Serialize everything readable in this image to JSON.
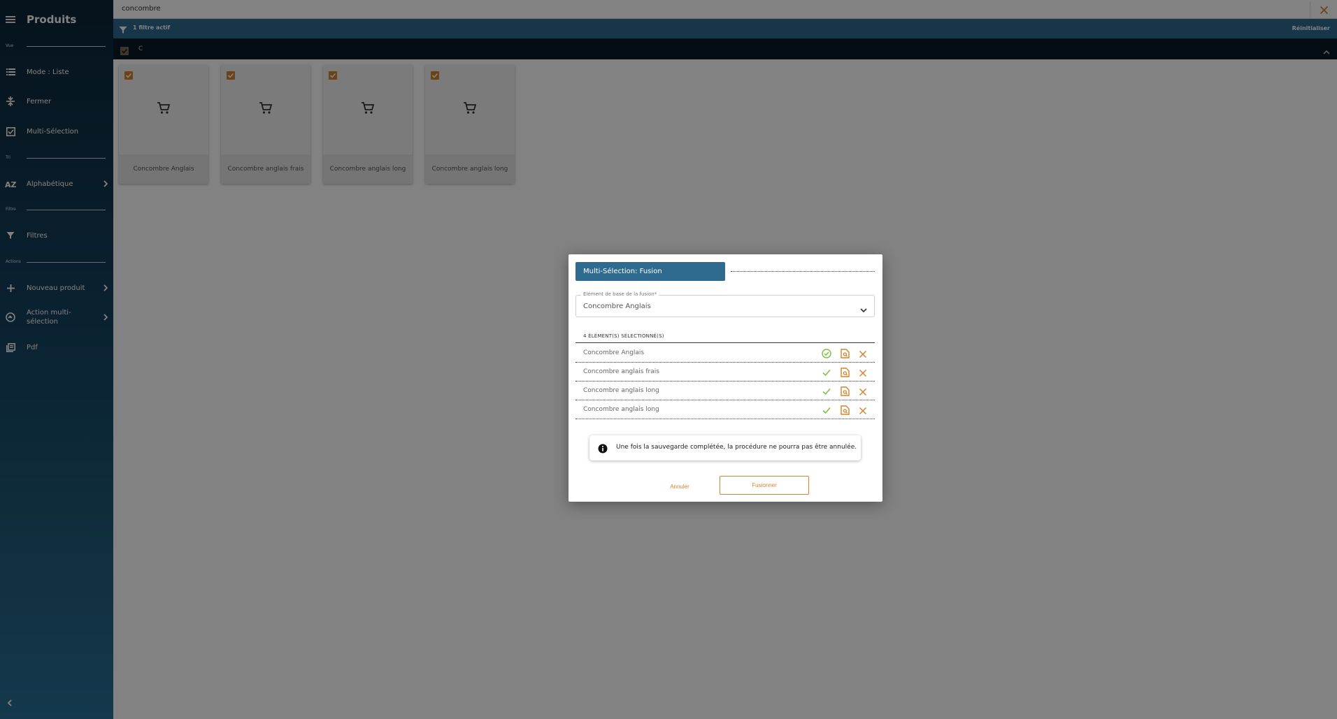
{
  "sidebar": {
    "title": "Produits",
    "sections": {
      "vue": "Vue",
      "tri": "Tri",
      "filtre": "Filtre",
      "actions": "Actions"
    },
    "items": {
      "mode": "Mode : Liste",
      "fermer": "Fermer",
      "multi": "Multi-Sélection",
      "alpha": "Alphabétique",
      "filtres": "Filtres",
      "nouveau": "Nouveau produit",
      "action_multi": "Action multi-sélection",
      "pdf": "Pdf"
    }
  },
  "search": {
    "value": "concombre"
  },
  "filterbar": {
    "count_label": "1 filtre actif",
    "reset_label": "Réinitialiser"
  },
  "group": {
    "letter": "C"
  },
  "products": [
    {
      "name": "Concombre Anglais"
    },
    {
      "name": "Concombre anglais frais"
    },
    {
      "name": "Concombre anglais long"
    },
    {
      "name": "Concombre anglais long"
    }
  ],
  "dialog": {
    "title": "Multi-Sélection: Fusion",
    "field_label": "Elément de base de la fusion*",
    "field_value": "Concombre Anglais",
    "list_header": "4 ÉLÉMENT(S) SÉLECTIONNÉ(S)",
    "rows": [
      {
        "name": "Concombre Anglais"
      },
      {
        "name": "Concombre anglais frais"
      },
      {
        "name": "Concombre anglais long"
      },
      {
        "name": "Concombre anglais long"
      }
    ],
    "info_text": "Une fois la sauvegarde complétée, la procédure ne pourra pas être annulée.",
    "cancel_label": "Annuler",
    "merge_label": "Fusionner"
  },
  "colors": {
    "sidebar_dark": "#0c2538",
    "primary": "#2e6b8f",
    "accent": "#d4822e",
    "success": "#7cc242"
  }
}
